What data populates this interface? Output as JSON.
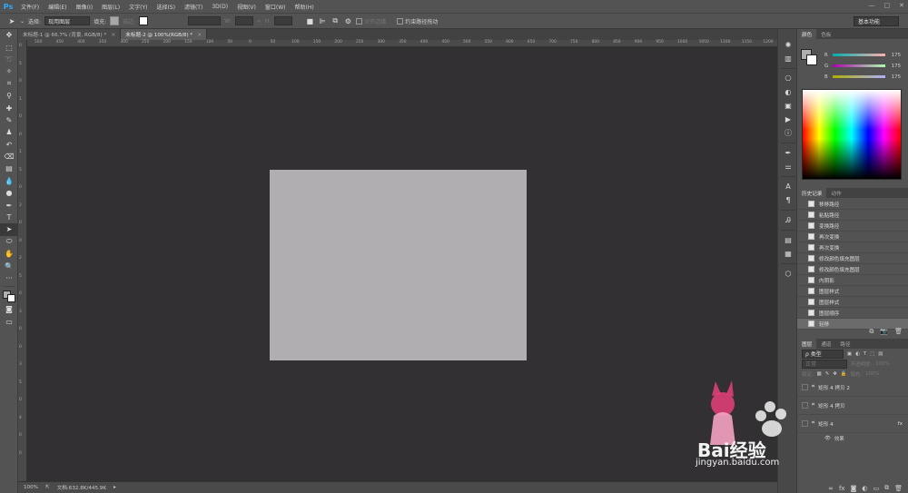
{
  "app": {
    "logo": "Ps"
  },
  "menu": {
    "items": [
      "文件(F)",
      "编辑(E)",
      "图像(I)",
      "图层(L)",
      "文字(Y)",
      "选择(S)",
      "滤镜(T)",
      "3D(D)",
      "视图(V)",
      "窗口(W)",
      "帮助(H)"
    ]
  },
  "window_controls": [
    "—",
    "□",
    "✕"
  ],
  "options": {
    "select_label": "选择:",
    "select_value": "现用图层",
    "fill_label": "填充:",
    "stroke_label": "描边:",
    "w_label": "W:",
    "h_label": "H:",
    "align_edges_label": "对齐边缘",
    "constrain_label": "约束路径拖动",
    "workspace": "基本功能"
  },
  "tabs": [
    {
      "label": "未标题-1 @ 66.7% (背景, RGB/8) *",
      "close": "×"
    },
    {
      "label": "未标题-2 @ 100%(RGB/8) *",
      "close": "×"
    }
  ],
  "ruler": {
    "top": [
      "500",
      "450",
      "400",
      "350",
      "300",
      "250",
      "200",
      "150",
      "100",
      "50",
      "0",
      "50",
      "100",
      "150",
      "200",
      "250",
      "300",
      "350",
      "400",
      "450",
      "500",
      "550",
      "600",
      "650",
      "700",
      "750",
      "800",
      "850",
      "900",
      "950",
      "1000",
      "1050",
      "1100",
      "1150",
      "1200"
    ],
    "left": [
      "0",
      "5",
      "0",
      "1",
      "0",
      "0",
      "1",
      "5",
      "0",
      "2",
      "0",
      "0",
      "2",
      "5",
      "0",
      "3",
      "0",
      "0",
      "3",
      "5",
      "0",
      "4",
      "0",
      "0"
    ]
  },
  "document": {
    "fill_color": "#b1aeb1"
  },
  "status": {
    "zoom": "100%",
    "doc_info": "文档:632.8K/445.9K",
    "arrow": "▸"
  },
  "color_panel": {
    "tabs": [
      "颜色",
      "色板"
    ],
    "channels": [
      {
        "label": "R",
        "value": "175"
      },
      {
        "label": "G",
        "value": "175"
      },
      {
        "label": "B",
        "value": "175"
      }
    ],
    "foreground": "#afafaf"
  },
  "history_panel": {
    "tabs": [
      "历史记录",
      "动作"
    ],
    "items": [
      "移移路径",
      "粘贴路径",
      "变换路径",
      "再次变换",
      "再次变换",
      "修改颜色填充图层",
      "修改颜色填充图层",
      "内阴影",
      "图层样式",
      "图层样式",
      "图层顺序",
      "轻移"
    ],
    "current_index": 11
  },
  "layers_panel": {
    "tabs": [
      "图层",
      "通道",
      "路径"
    ],
    "kind_filter": "ρ 类型",
    "blend_mode": "正常",
    "opacity_label": "不透明度:",
    "opacity_value": "100%",
    "lock_label": "锁定:",
    "fill_label": "填充:",
    "fill_value": "100%",
    "layers": [
      "矩形 4 拷贝 2",
      "矩形 4 拷贝",
      "矩形 4"
    ],
    "effects_label": "效果",
    "fx": "fx"
  },
  "watermark": {
    "brand": "Bai经验",
    "url": "jingyan.baidu.com"
  }
}
